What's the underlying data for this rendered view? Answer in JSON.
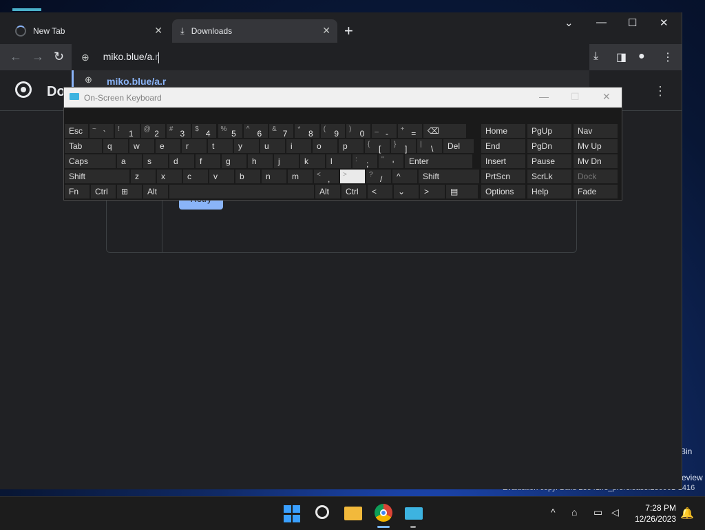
{
  "browser": {
    "tabs": [
      {
        "title": "New Tab",
        "close": "✕"
      },
      {
        "title": "Downloads",
        "close": "✕"
      }
    ],
    "new_tab": "+",
    "window_controls": {
      "tablist": "⌄",
      "minimize": "—",
      "maximize": "☐",
      "close": "✕"
    },
    "toolbar": {
      "back": "←",
      "forward": "→",
      "reload": "↻",
      "site_icon": "⊕"
    },
    "omnibox": {
      "typed": "miko.blue/a.",
      "suggestion_tail": "r"
    },
    "dropdown": {
      "suggestion": "miko.blue/a.r"
    },
    "toolbar_right": {
      "download": "⤓",
      "sidepanel": "◨",
      "profile": "●",
      "menu": "⋮"
    }
  },
  "page": {
    "title": "Downloads",
    "title_visible": "Do",
    "menu": "⋮",
    "retry_label": "Retry"
  },
  "osk": {
    "title": "On-Screen Keyboard",
    "controls": {
      "minimize": "—",
      "maximize": "☐",
      "close": "✕"
    },
    "row1": [
      {
        "mn": "Esc"
      },
      {
        "sh": "~",
        "mn": "`"
      },
      {
        "sh": "!",
        "mn": "1"
      },
      {
        "sh": "@",
        "mn": "2"
      },
      {
        "sh": "#",
        "mn": "3"
      },
      {
        "sh": "$",
        "mn": "4"
      },
      {
        "sh": "%",
        "mn": "5"
      },
      {
        "sh": "^",
        "mn": "6"
      },
      {
        "sh": "&",
        "mn": "7"
      },
      {
        "sh": "*",
        "mn": "8"
      },
      {
        "sh": "(",
        "mn": "9"
      },
      {
        "sh": ")",
        "mn": "0"
      },
      {
        "sh": "_",
        "mn": "-"
      },
      {
        "sh": "+",
        "mn": "="
      },
      {
        "mn": "⌫"
      }
    ],
    "row2": [
      "Tab",
      "q",
      "w",
      "e",
      "r",
      "t",
      "y",
      "u",
      "i",
      "o",
      "p"
    ],
    "row2_extra": [
      {
        "sh": "{",
        "mn": "["
      },
      {
        "sh": "}",
        "mn": "]"
      },
      {
        "sh": "|",
        "mn": "\\"
      },
      {
        "mn": "Del"
      }
    ],
    "row3": [
      "Caps",
      "a",
      "s",
      "d",
      "f",
      "g",
      "h",
      "j",
      "k",
      "l"
    ],
    "row3_extra": [
      {
        "sh": ":",
        "mn": ";"
      },
      {
        "sh": "\"",
        "mn": "'"
      },
      {
        "mn": "Enter"
      }
    ],
    "row4": [
      "Shift",
      "z",
      "x",
      "c",
      "v",
      "b",
      "n",
      "m"
    ],
    "row4_extra": [
      {
        "sh": "<",
        "mn": ","
      },
      {
        "sh": ">",
        "mn": "."
      },
      {
        "sh": "?",
        "mn": "/"
      },
      {
        "mn": "^"
      },
      {
        "mn": "Shift"
      }
    ],
    "row5": {
      "fn": "Fn",
      "ctrl": "Ctrl",
      "win": "⊞",
      "alt": "Alt",
      "alt_r": "Alt",
      "ctrl_r": "Ctrl",
      "left": "<",
      "down": "⌄",
      "right": ">",
      "menu": "▤"
    },
    "nav_keys": [
      [
        "Home",
        "PgUp",
        "Nav"
      ],
      [
        "End",
        "PgDn",
        "Mv Up"
      ],
      [
        "Insert",
        "Pause",
        "Mv Dn"
      ],
      [
        "PrtScn",
        "ScrLk",
        "Dock"
      ],
      [
        "Options",
        "Help",
        "Fade"
      ]
    ]
  },
  "desktop": {
    "recycle_bin": "Bin",
    "side_text": "eview",
    "watermark": "Evaluation copy. Build 23541.rs_prerelease.230901-1416"
  },
  "taskbar": {
    "tray": {
      "chevron": "^",
      "network": "⌂",
      "display": "▭",
      "volume": "◁"
    },
    "time": "7:28 PM",
    "date": "12/26/2023",
    "bell": "🔔"
  }
}
